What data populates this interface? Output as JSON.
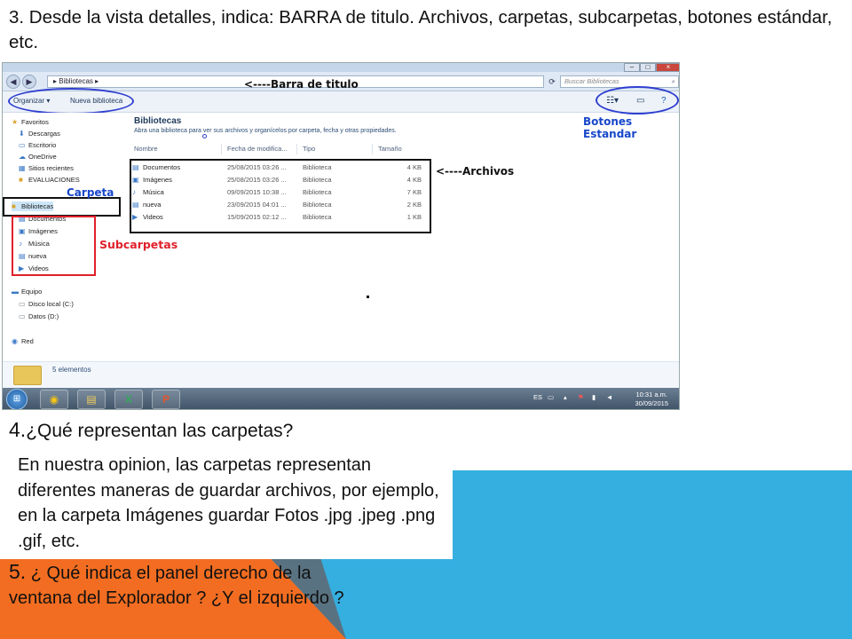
{
  "slide": {
    "q3": "3. Desde la vista detalles, indica: BARRA de titulo. Archivos, carpetas, subcarpetas, botones estándar, etc.",
    "q4_num": "4.",
    "q4_text": "¿Qué representan las carpetas?",
    "answer": "En nuestra opinion, las carpetas representan diferentes maneras de guardar archivos, por ejemplo, en la carpeta Imágenes guardar Fotos .jpg .jpeg .png .gif, etc.",
    "q5_num": "5.",
    "q5_text": "¿ Qué indica el panel derecho de la ventana del Explorador ? ¿Y el izquierdo ?",
    "colors": {
      "blue": "#35afe0",
      "orange": "#f26d21",
      "annotation_blue": "#1746c9",
      "annotation_red": "#e0202a"
    }
  },
  "explorer": {
    "address": "▸  Bibliotecas  ▸",
    "search_placeholder": "Buscar Bibliotecas",
    "toolbar": {
      "organize": "Organizar ▾",
      "new_library": "Nueva biblioteca"
    },
    "annotations": {
      "title_bar": "<----Barra de titulo",
      "standard_buttons": "Botones Estandar",
      "files": "<----Archivos",
      "folder": "Carpeta",
      "subfolders": "Subcarpetas"
    },
    "nav": {
      "favorites": "Favoritos",
      "downloads": "Descargas",
      "desktop": "Escritorio",
      "onedrive": "OneDrive",
      "recent": "Sitios recientes",
      "evaluaciones": "EVALUACIONES",
      "libraries": "Bibliotecas",
      "documents": "Documentos",
      "images": "Imágenes",
      "music": "Música",
      "nueva": "nueva",
      "videos": "Videos",
      "computer": "Equipo",
      "disk_c": "Disco local (C:)",
      "disk_d": "Datos (D:)",
      "network": "Red"
    },
    "library_title": "Bibliotecas",
    "library_subtitle": "Abra una biblioteca para ver sus archivos y organícelos por carpeta, fecha y otras propiedades.",
    "columns": [
      "Nombre",
      "Fecha de modifica...",
      "Tipo",
      "Tamaño"
    ],
    "files": [
      {
        "name": "Documentos",
        "date": "25/08/2015 03:26 ...",
        "type": "Biblioteca",
        "size": "4 KB"
      },
      {
        "name": "Imágenes",
        "date": "25/08/2015 03:26 ...",
        "type": "Biblioteca",
        "size": "4 KB"
      },
      {
        "name": "Música",
        "date": "09/09/2015 10:38 ...",
        "type": "Biblioteca",
        "size": "7 KB"
      },
      {
        "name": "nueva",
        "date": "23/09/2015 04:01 ...",
        "type": "Biblioteca",
        "size": "2 KB"
      },
      {
        "name": "Videos",
        "date": "15/09/2015 02:12 ...",
        "type": "Biblioteca",
        "size": "1 KB"
      }
    ],
    "status": "5 elementos",
    "taskbar": {
      "lang": "ES",
      "time": "10:31 a.m.",
      "date": "30/09/2015"
    }
  }
}
